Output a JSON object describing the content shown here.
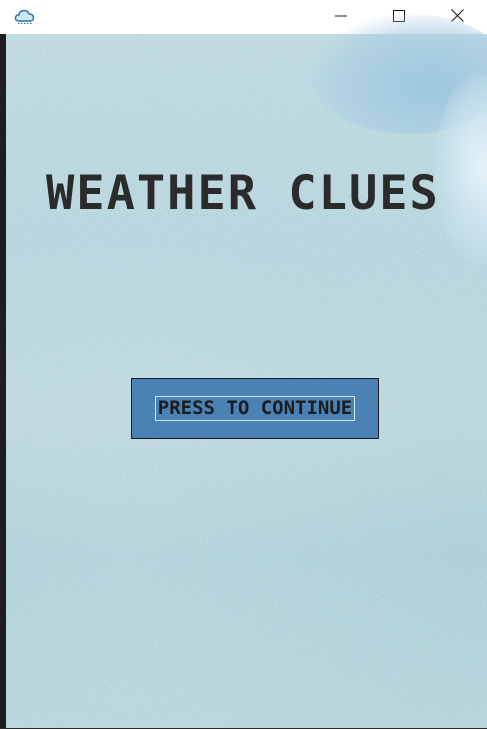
{
  "window": {
    "app_icon": "cloud-icon",
    "controls": {
      "minimize": "minimize-icon",
      "maximize": "maximize-icon",
      "close": "close-icon"
    }
  },
  "game": {
    "title": "WEATHER CLUES",
    "continue_label": "PRESS TO CONTINUE"
  },
  "colors": {
    "button_fill": "#4a82b5",
    "title_text": "#2b2b2b",
    "background": "#b8d6dc"
  }
}
